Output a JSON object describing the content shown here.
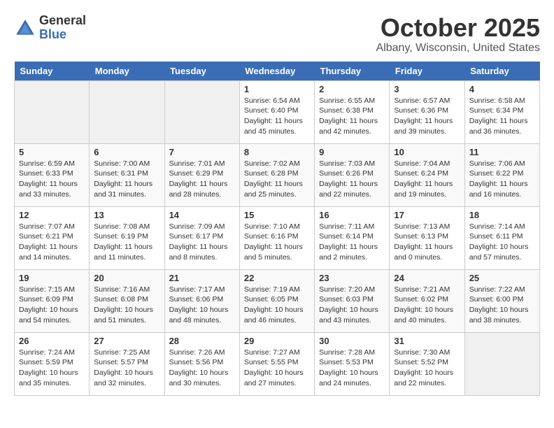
{
  "logo": {
    "general": "General",
    "blue": "Blue"
  },
  "title": "October 2025",
  "location": "Albany, Wisconsin, United States",
  "days_of_week": [
    "Sunday",
    "Monday",
    "Tuesday",
    "Wednesday",
    "Thursday",
    "Friday",
    "Saturday"
  ],
  "weeks": [
    [
      {
        "day": "",
        "info": ""
      },
      {
        "day": "",
        "info": ""
      },
      {
        "day": "",
        "info": ""
      },
      {
        "day": "1",
        "info": "Sunrise: 6:54 AM\nSunset: 6:40 PM\nDaylight: 11 hours and 45 minutes."
      },
      {
        "day": "2",
        "info": "Sunrise: 6:55 AM\nSunset: 6:38 PM\nDaylight: 11 hours and 42 minutes."
      },
      {
        "day": "3",
        "info": "Sunrise: 6:57 AM\nSunset: 6:36 PM\nDaylight: 11 hours and 39 minutes."
      },
      {
        "day": "4",
        "info": "Sunrise: 6:58 AM\nSunset: 6:34 PM\nDaylight: 11 hours and 36 minutes."
      }
    ],
    [
      {
        "day": "5",
        "info": "Sunrise: 6:59 AM\nSunset: 6:33 PM\nDaylight: 11 hours and 33 minutes."
      },
      {
        "day": "6",
        "info": "Sunrise: 7:00 AM\nSunset: 6:31 PM\nDaylight: 11 hours and 31 minutes."
      },
      {
        "day": "7",
        "info": "Sunrise: 7:01 AM\nSunset: 6:29 PM\nDaylight: 11 hours and 28 minutes."
      },
      {
        "day": "8",
        "info": "Sunrise: 7:02 AM\nSunset: 6:28 PM\nDaylight: 11 hours and 25 minutes."
      },
      {
        "day": "9",
        "info": "Sunrise: 7:03 AM\nSunset: 6:26 PM\nDaylight: 11 hours and 22 minutes."
      },
      {
        "day": "10",
        "info": "Sunrise: 7:04 AM\nSunset: 6:24 PM\nDaylight: 11 hours and 19 minutes."
      },
      {
        "day": "11",
        "info": "Sunrise: 7:06 AM\nSunset: 6:22 PM\nDaylight: 11 hours and 16 minutes."
      }
    ],
    [
      {
        "day": "12",
        "info": "Sunrise: 7:07 AM\nSunset: 6:21 PM\nDaylight: 11 hours and 14 minutes."
      },
      {
        "day": "13",
        "info": "Sunrise: 7:08 AM\nSunset: 6:19 PM\nDaylight: 11 hours and 11 minutes."
      },
      {
        "day": "14",
        "info": "Sunrise: 7:09 AM\nSunset: 6:17 PM\nDaylight: 11 hours and 8 minutes."
      },
      {
        "day": "15",
        "info": "Sunrise: 7:10 AM\nSunset: 6:16 PM\nDaylight: 11 hours and 5 minutes."
      },
      {
        "day": "16",
        "info": "Sunrise: 7:11 AM\nSunset: 6:14 PM\nDaylight: 11 hours and 2 minutes."
      },
      {
        "day": "17",
        "info": "Sunrise: 7:13 AM\nSunset: 6:13 PM\nDaylight: 11 hours and 0 minutes."
      },
      {
        "day": "18",
        "info": "Sunrise: 7:14 AM\nSunset: 6:11 PM\nDaylight: 10 hours and 57 minutes."
      }
    ],
    [
      {
        "day": "19",
        "info": "Sunrise: 7:15 AM\nSunset: 6:09 PM\nDaylight: 10 hours and 54 minutes."
      },
      {
        "day": "20",
        "info": "Sunrise: 7:16 AM\nSunset: 6:08 PM\nDaylight: 10 hours and 51 minutes."
      },
      {
        "day": "21",
        "info": "Sunrise: 7:17 AM\nSunset: 6:06 PM\nDaylight: 10 hours and 48 minutes."
      },
      {
        "day": "22",
        "info": "Sunrise: 7:19 AM\nSunset: 6:05 PM\nDaylight: 10 hours and 46 minutes."
      },
      {
        "day": "23",
        "info": "Sunrise: 7:20 AM\nSunset: 6:03 PM\nDaylight: 10 hours and 43 minutes."
      },
      {
        "day": "24",
        "info": "Sunrise: 7:21 AM\nSunset: 6:02 PM\nDaylight: 10 hours and 40 minutes."
      },
      {
        "day": "25",
        "info": "Sunrise: 7:22 AM\nSunset: 6:00 PM\nDaylight: 10 hours and 38 minutes."
      }
    ],
    [
      {
        "day": "26",
        "info": "Sunrise: 7:24 AM\nSunset: 5:59 PM\nDaylight: 10 hours and 35 minutes."
      },
      {
        "day": "27",
        "info": "Sunrise: 7:25 AM\nSunset: 5:57 PM\nDaylight: 10 hours and 32 minutes."
      },
      {
        "day": "28",
        "info": "Sunrise: 7:26 AM\nSunset: 5:56 PM\nDaylight: 10 hours and 30 minutes."
      },
      {
        "day": "29",
        "info": "Sunrise: 7:27 AM\nSunset: 5:55 PM\nDaylight: 10 hours and 27 minutes."
      },
      {
        "day": "30",
        "info": "Sunrise: 7:28 AM\nSunset: 5:53 PM\nDaylight: 10 hours and 24 minutes."
      },
      {
        "day": "31",
        "info": "Sunrise: 7:30 AM\nSunset: 5:52 PM\nDaylight: 10 hours and 22 minutes."
      },
      {
        "day": "",
        "info": ""
      }
    ]
  ]
}
